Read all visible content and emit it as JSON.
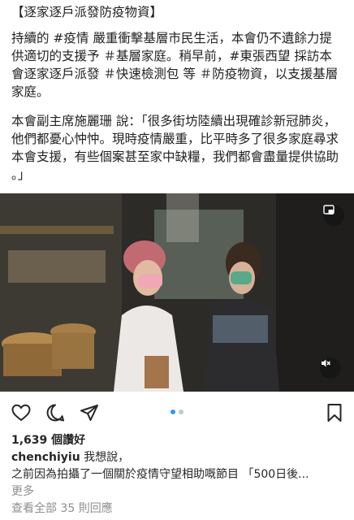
{
  "caption": {
    "title": "【逐家逐戶派發防疫物資】",
    "paragraph1": "持續的 #疫情 嚴重衝擊基層市民生活，本會仍不遺餘力提供適切的支援予 ＃基層家庭。稍早前，#東張西望 採訪本會逐家逐戶派發 ＃快速檢測包 等 ＃防疫物資，以支援基層家庭。",
    "paragraph2": "本會副主席施麗珊 說：「很多街坊陸續出現確診新冠肺炎，他們都憂心忡忡。現時疫情嚴重，比平時多了很多家庭尋求本會支援，有些個案甚至家中缺糧，我們都會盡量提供協助 。」"
  },
  "media": {
    "pip_icon": "picture-in-picture-icon",
    "mute_icon": "muted-speaker-icon"
  },
  "carousel": {
    "count": 2,
    "active": 1
  },
  "likes": "1,639 個讚好",
  "comment": {
    "user": "chenchiyiu",
    "text_line1": "我想說，",
    "text_line2": "之前因為拍攝了一個關於疫情守望相助嘅節目 「500日後...",
    "more": "更多"
  },
  "view_comments": "查看全部 35 則回應"
}
